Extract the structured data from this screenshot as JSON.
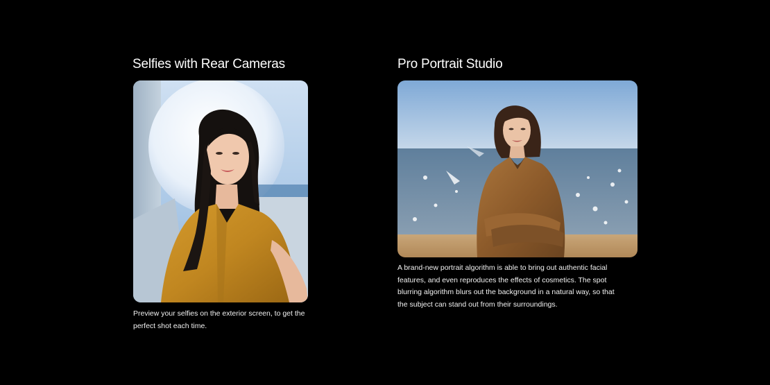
{
  "features": [
    {
      "title": "Selfies with Rear Cameras",
      "image_subject": "selfie-portrait",
      "caption": "Preview your selfies on the exterior screen, to get the perfect shot each time."
    },
    {
      "title": "Pro Portrait Studio",
      "image_subject": "beach-portrait",
      "caption": "A brand-new portrait algorithm is able to bring out authentic facial features, and even reproduces the effects of cosmetics. The spot blurring algorithm blurs out the background in a natural way, so that the subject can stand out from their surroundings."
    }
  ],
  "colors": {
    "background": "#000000",
    "text": "#ffffff"
  }
}
